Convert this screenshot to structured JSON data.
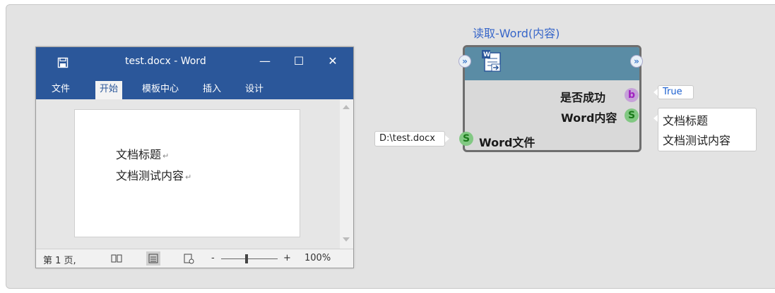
{
  "word_window": {
    "title": "test.docx - Word",
    "controls": {
      "minimize": "—",
      "maximize": "☐",
      "close": "✕"
    },
    "tabs": [
      {
        "label": "文件"
      },
      {
        "label": "开始"
      },
      {
        "label": "模板中心"
      },
      {
        "label": "插入"
      },
      {
        "label": "设计"
      }
    ],
    "active_tab": "开始",
    "document_lines": [
      "文档标题",
      "文档测试内容"
    ],
    "paragraph_mark": "↵",
    "status": {
      "page": "第 1 页,",
      "zoom_minus": "-",
      "zoom_plus": "+",
      "zoom_level": "100%"
    },
    "colors": {
      "brand": "#2b579a"
    }
  },
  "node": {
    "title": "读取-Word(内容)",
    "outputs": [
      {
        "label": "是否成功",
        "type": "b",
        "value": "True"
      },
      {
        "label": "Word内容",
        "type": "S",
        "values": [
          "文档标题",
          "文档测试内容"
        ]
      }
    ],
    "input": {
      "label": "Word文件",
      "type": "S",
      "value": "D:\\test.docx"
    },
    "flow_in": "»",
    "flow_out": "»",
    "colors": {
      "header": "#5a8ca5",
      "title": "#3766c9"
    }
  }
}
